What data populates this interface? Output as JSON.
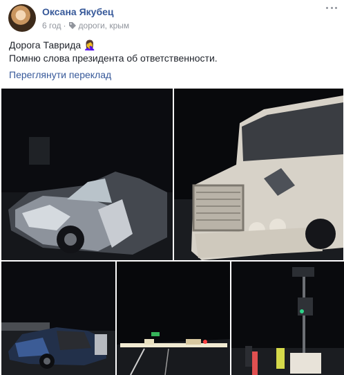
{
  "post": {
    "author": "Оксана Якубец",
    "time": "6 год",
    "separator": "·",
    "tags": "дороги, крым",
    "line1": "Дорога Таврида 🤦‍♀️",
    "line2": "Помню слова президента об ответственности.",
    "translate": "Переглянути переклад"
  },
  "photos": [
    {
      "name": "photo-crashed-car"
    },
    {
      "name": "photo-truck"
    },
    {
      "name": "photo-blue-car"
    },
    {
      "name": "photo-road-night"
    },
    {
      "name": "photo-traffic-light"
    }
  ],
  "icons": {
    "tag": "tag-icon",
    "more": "more-options-icon"
  }
}
